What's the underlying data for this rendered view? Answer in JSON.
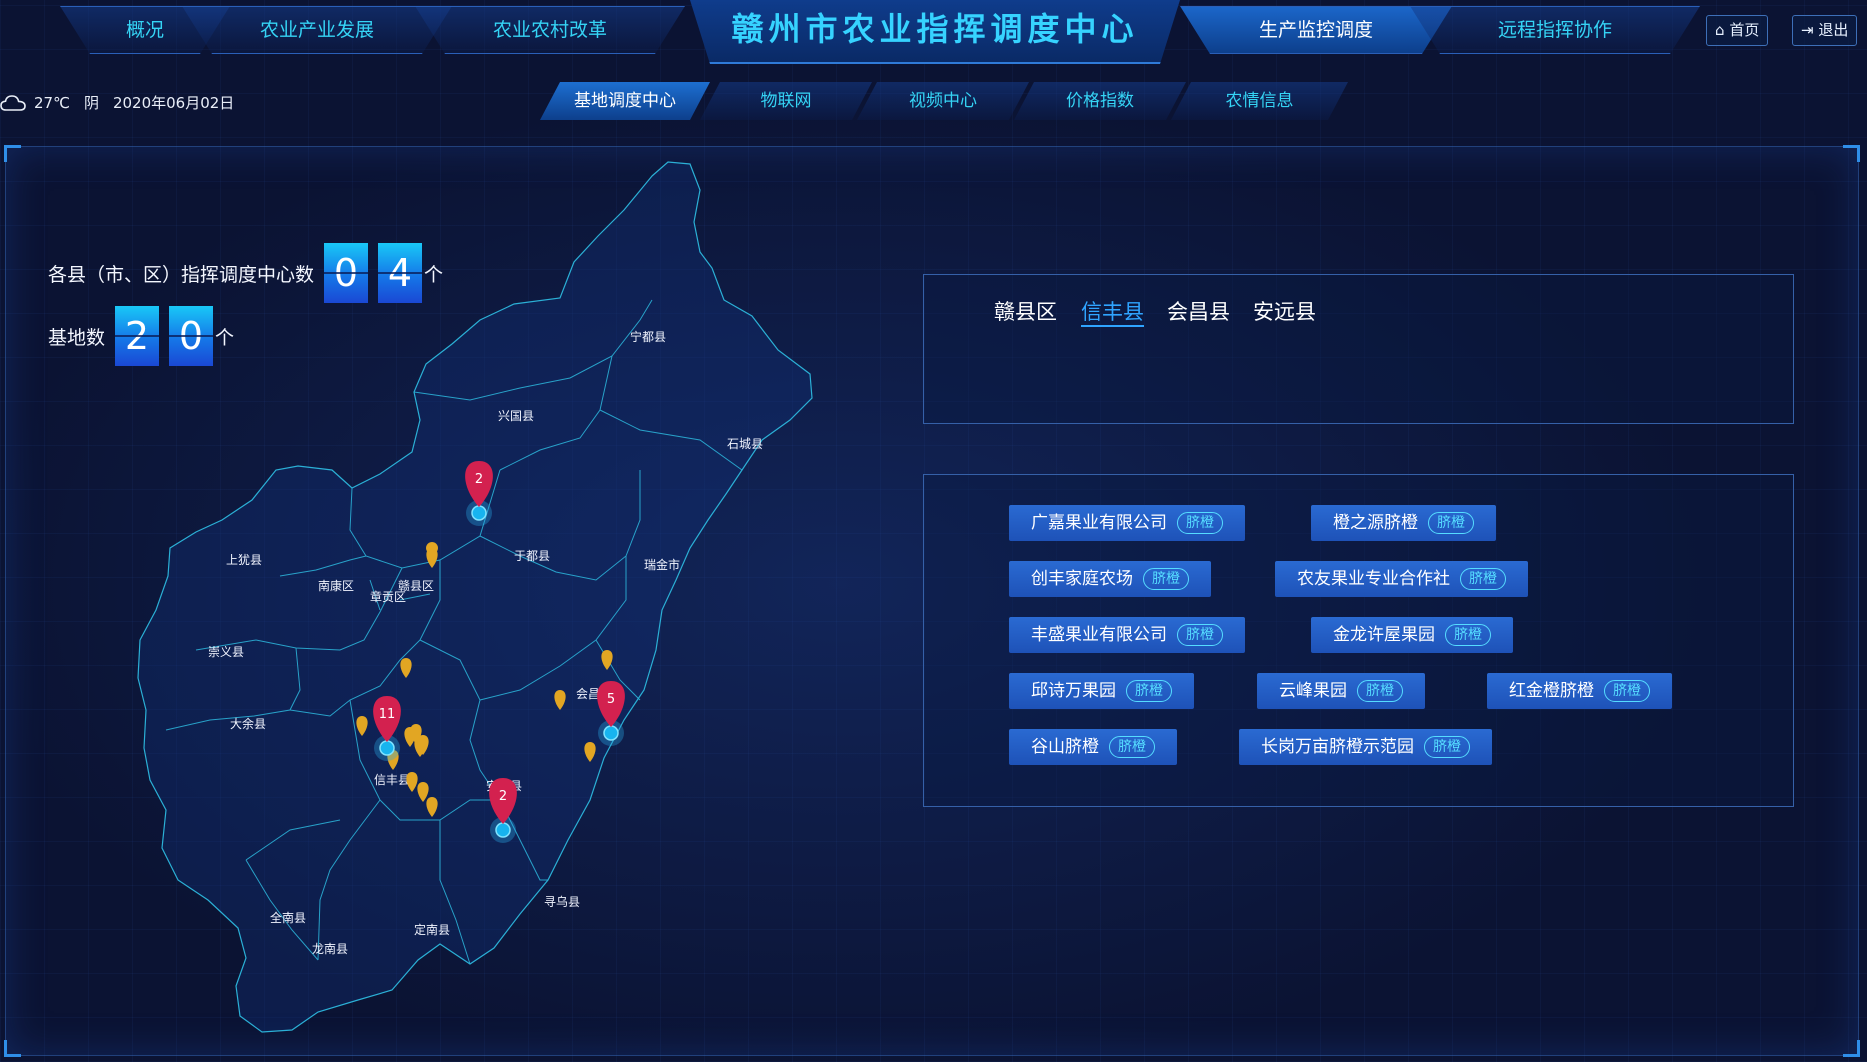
{
  "nav": {
    "left_tabs": [
      "概况",
      "农业产业发展",
      "农业农村改革"
    ],
    "title": "赣州市农业指挥调度中心",
    "right_tabs": [
      "生产监控调度",
      "远程指挥协作"
    ],
    "home": "首页",
    "logout": "退出"
  },
  "weather": {
    "temp": "27℃",
    "condition": "阴",
    "date": "2020年06月02日",
    "icon": "cloud-icon"
  },
  "subnav": [
    "基地调度中心",
    "物联网",
    "视频中心",
    "价格指数",
    "农情信息"
  ],
  "stats": {
    "center_label": "各县（市、区）指挥调度中心数",
    "center_digits": [
      "0",
      "4"
    ],
    "base_label": "基地数",
    "base_digits": [
      "2",
      "0"
    ],
    "unit": "个"
  },
  "counties": [
    "赣县区",
    "信丰县",
    "会昌县",
    "安远县"
  ],
  "active_county": "信丰县",
  "bases": [
    {
      "name": "广嘉果业有限公司",
      "tag": "脐橙"
    },
    {
      "name": "橙之源脐橙",
      "tag": "脐橙"
    },
    {
      "name": "创丰家庭农场",
      "tag": "脐橙"
    },
    {
      "name": "农友果业专业合作社",
      "tag": "脐橙"
    },
    {
      "name": "丰盛果业有限公司",
      "tag": "脐橙"
    },
    {
      "name": "金龙许屋果园",
      "tag": "脐橙"
    },
    {
      "name": "邱诗万果园",
      "tag": "脐橙"
    },
    {
      "name": "云峰果园",
      "tag": "脐橙"
    },
    {
      "name": "红金橙脐橙",
      "tag": "脐橙"
    },
    {
      "name": "谷山脐橙",
      "tag": "脐橙"
    },
    {
      "name": "长岗万亩脐橙示范园",
      "tag": "脐橙"
    }
  ],
  "map": {
    "labels": [
      "宁都县",
      "兴国县",
      "石城县",
      "于都县",
      "瑞金市",
      "上犹县",
      "南康区",
      "赣县区",
      "章贡区",
      "崇义县",
      "大余县",
      "会昌县",
      "信丰县",
      "安远县",
      "寻乌县",
      "全南县",
      "龙南县",
      "定南县"
    ],
    "markers": [
      {
        "count": "2",
        "county": "兴国县"
      },
      {
        "count": "11",
        "county": "信丰县"
      },
      {
        "count": "5",
        "county": "会昌县"
      },
      {
        "count": "2",
        "county": "安远县"
      }
    ]
  }
}
